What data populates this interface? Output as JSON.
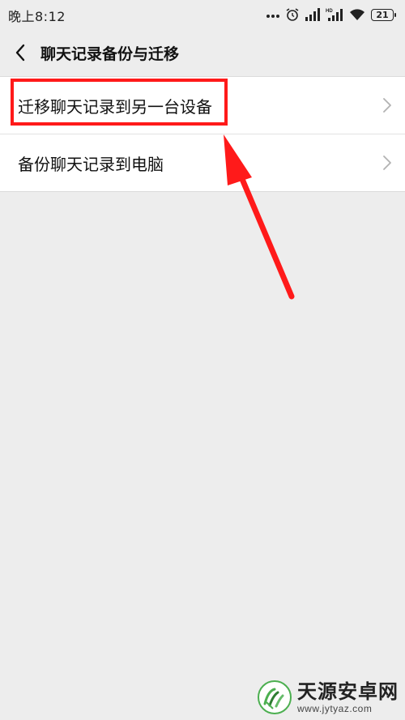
{
  "status_bar": {
    "time": "晚上8:12",
    "icons": [
      "more-dots-icon",
      "alarm-icon",
      "signal-icon",
      "hd-signal-icon",
      "wifi-icon",
      "battery-icon"
    ],
    "battery_level": "21"
  },
  "nav": {
    "back_icon": "chevron-left-icon",
    "title": "聊天记录备份与迁移"
  },
  "list": {
    "items": [
      {
        "label": "迁移聊天记录到另一台设备",
        "icon": "chevron-right-icon"
      },
      {
        "label": "备份聊天记录到电脑",
        "icon": "chevron-right-icon"
      }
    ]
  },
  "annotation": {
    "highlight_color": "#ff1a1a",
    "arrow_color": "#ff1a1a"
  },
  "watermark": {
    "name": "天源安卓网",
    "url": "www.jytyaz.com"
  }
}
